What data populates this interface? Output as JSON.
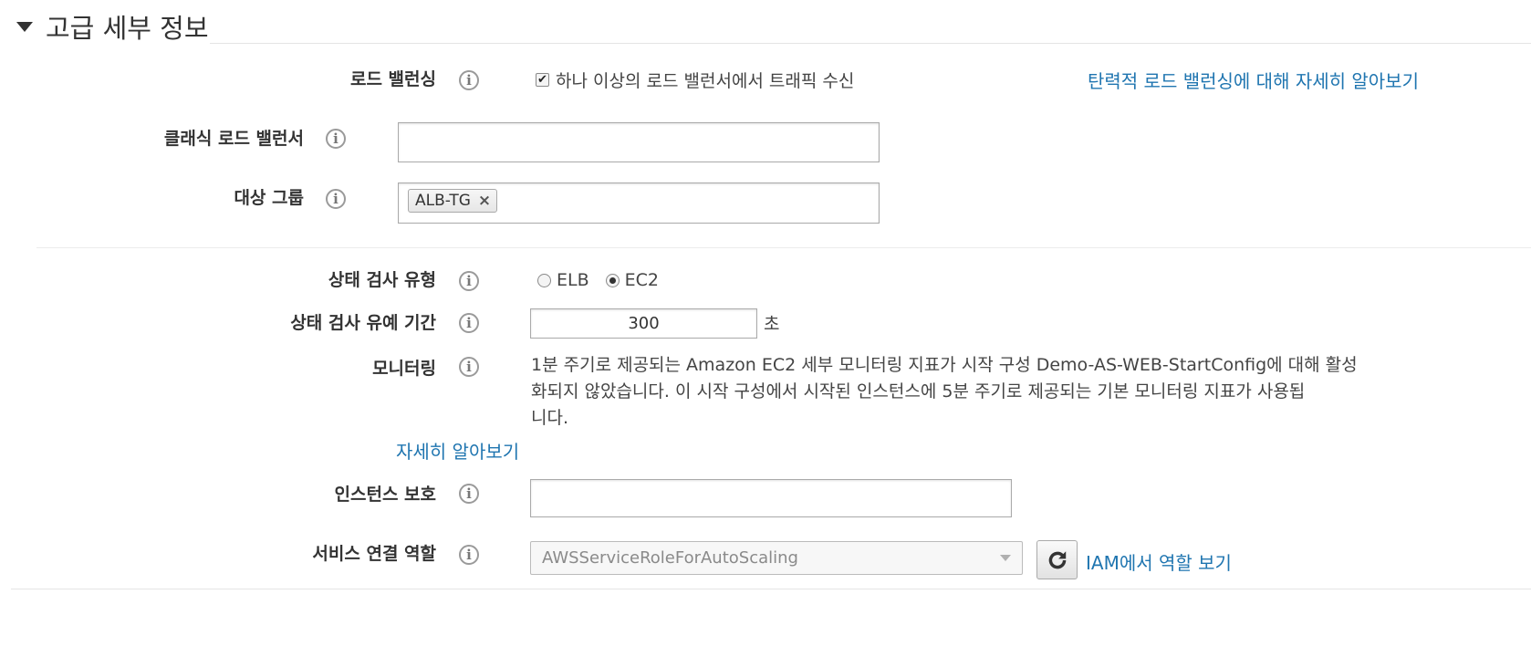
{
  "section": {
    "title": "고급 세부 정보"
  },
  "load_balancing": {
    "label": "로드 밸런싱",
    "checkbox_label": "하나 이상의 로드 밸런서에서 트래픽 수신",
    "checkbox_checked": true,
    "learn_more": "탄력적 로드 밸런싱에 대해 자세히 알아보기"
  },
  "classic_lb": {
    "label": "클래식 로드 밸런서",
    "value": ""
  },
  "target_groups": {
    "label": "대상 그룹",
    "tags": [
      "ALB-TG"
    ]
  },
  "health_check_type": {
    "label": "상태 검사 유형",
    "options": [
      "ELB",
      "EC2"
    ],
    "selected": "EC2"
  },
  "health_check_grace": {
    "label": "상태 검사 유예 기간",
    "value": "300",
    "unit": "초"
  },
  "monitoring": {
    "label": "모니터링",
    "lines": [
      "1분 주기로 제공되는 Amazon EC2 세부 모니터링 지표가 시작 구성 Demo-AS-WEB-StartConfig에 대해 활성",
      "화되지 않았습니다. 이 시작 구성에서 시작된 인스턴스에 5분 주기로 제공되는 기본 모니터링 지표가 사용됩",
      "니다."
    ],
    "learn_more": "자세히 알아보기"
  },
  "instance_protection": {
    "label": "인스턴스 보호",
    "value": ""
  },
  "service_role": {
    "label": "서비스 연결 역할",
    "selected": "AWSServiceRoleForAutoScaling",
    "iam_link": "IAM에서 역할 보기"
  },
  "icons": {
    "info": "info-icon",
    "refresh": "refresh-icon",
    "expand": "triangle-down-icon",
    "remove": "close-icon"
  },
  "colors": {
    "link": "#1f75b0",
    "label": "#333333"
  }
}
